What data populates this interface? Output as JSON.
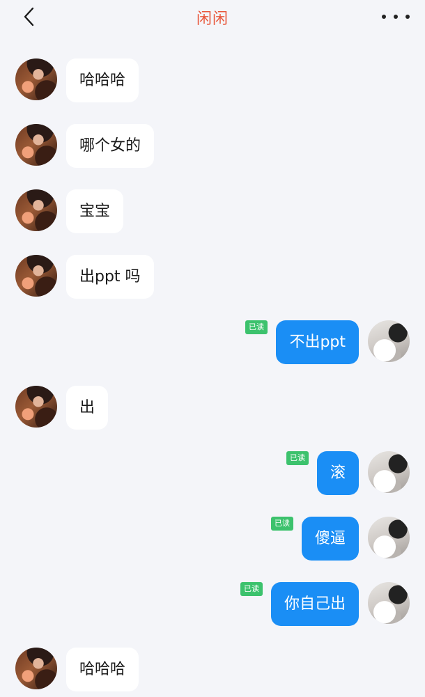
{
  "header": {
    "title": "闲闲",
    "back_icon": "chevron-left-icon",
    "more_icon": "more-horizontal-icon"
  },
  "colors": {
    "title": "#e8583c",
    "outgoing_bubble": "#1a8ef5",
    "incoming_bubble": "#ffffff",
    "read_badge": "#3cc26d",
    "background": "#f4f5f9"
  },
  "messages": [
    {
      "direction": "in",
      "text": "哈哈哈"
    },
    {
      "direction": "in",
      "text": "哪个女的"
    },
    {
      "direction": "in",
      "text": "宝宝"
    },
    {
      "direction": "in",
      "text": "出ppt 吗"
    },
    {
      "direction": "out",
      "text": "不出ppt",
      "status": "已读"
    },
    {
      "direction": "in",
      "text": "出"
    },
    {
      "direction": "out",
      "text": "滚",
      "status": "已读"
    },
    {
      "direction": "out",
      "text": "傻逼",
      "status": "已读"
    },
    {
      "direction": "out",
      "text": "你自己出",
      "status": "已读"
    },
    {
      "direction": "in",
      "text": "哈哈哈"
    }
  ]
}
